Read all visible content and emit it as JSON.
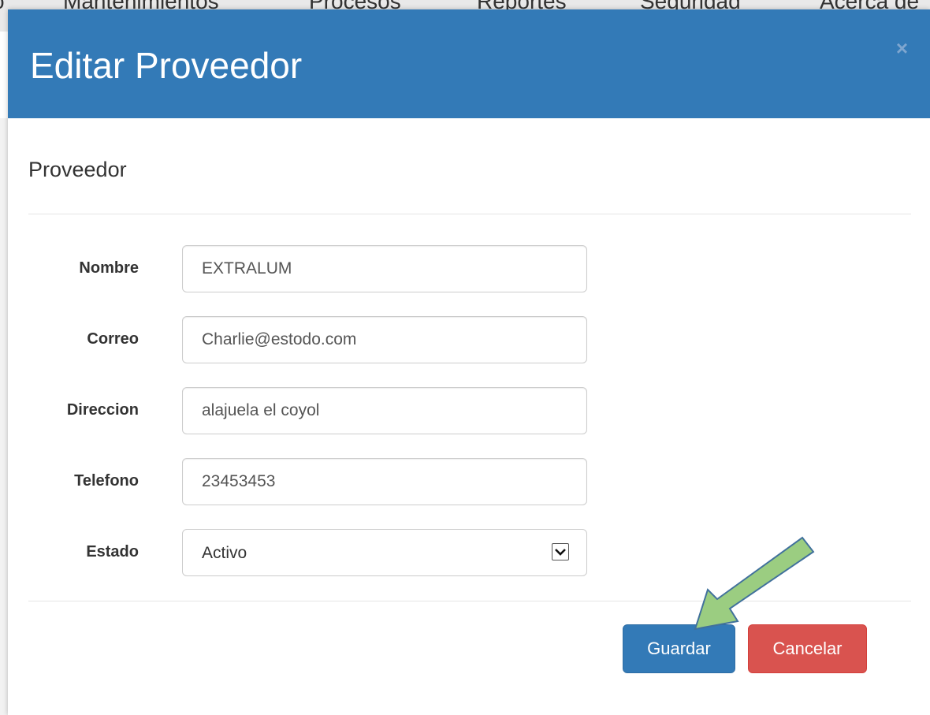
{
  "background_nav": {
    "items": [
      "o",
      "Mantenimientos",
      "Procesos",
      "Reportes",
      "Seguridad",
      "Acerca de"
    ]
  },
  "modal": {
    "title": "Editar Proveedor",
    "close_icon": "close-icon",
    "close_label": "×",
    "section_title": "Proveedor",
    "fields": [
      {
        "label": "Nombre",
        "value": "EXTRALUM"
      },
      {
        "label": "Correo",
        "value": "Charlie@estodo.com"
      },
      {
        "label": "Direccion",
        "value": "alajuela el coyol"
      },
      {
        "label": "Telefono",
        "value": "23453453"
      }
    ],
    "estado": {
      "label": "Estado",
      "selected": "Activo"
    },
    "buttons": {
      "save_label": "Guardar",
      "cancel_label": "Cancelar"
    }
  },
  "annotation": {
    "icon": "green-arrow-icon"
  },
  "colors": {
    "header": "#337ab7",
    "primary_button": "#337ab7",
    "danger_button": "#d9534f",
    "arrow_fill": "#9bcd81",
    "arrow_stroke": "#41719c"
  }
}
